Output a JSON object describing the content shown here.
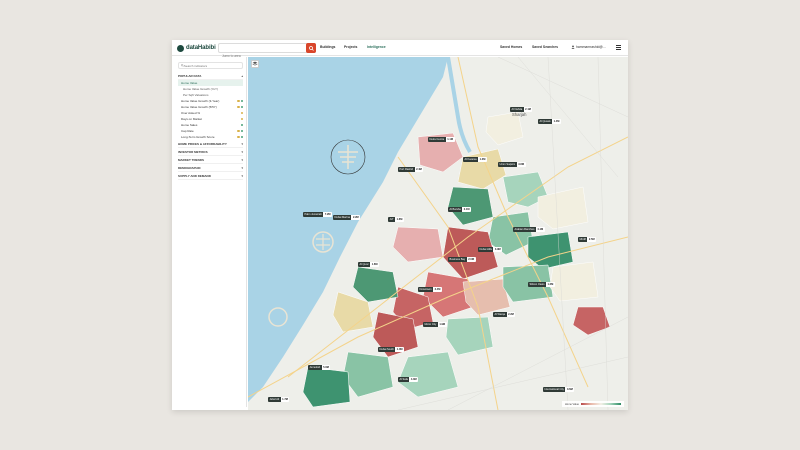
{
  "app": {
    "logo_text": "dataHabibi",
    "search_placeholder": "Jump to area",
    "nav": [
      "Buildings",
      "Projects",
      "Intelligence"
    ],
    "nav_active": "Intelligence",
    "right_links": [
      "Saved Homes",
      "Saved Searches"
    ],
    "user": "hammamrashid@..."
  },
  "sidebar": {
    "search_placeholder": "Search indicators",
    "sections": [
      {
        "title": "POPULAR DATA",
        "items": [
          {
            "label": "Home Value",
            "selected": true
          },
          {
            "label": "Home Value Growth (YoY)",
            "sub": true
          },
          {
            "label": "Per Sqft Valuations",
            "sub": true
          },
          {
            "label": "Home Value Growth (3-Year)",
            "dots": [
              "#d9b24a",
              "#4aa27a"
            ]
          },
          {
            "label": "Home Value Growth (5/5Y)",
            "dots": [
              "#d9b24a",
              "#4aa27a"
            ]
          },
          {
            "label": "Over Asked %",
            "dots": [
              "#d9b24a"
            ]
          },
          {
            "label": "Days on Market",
            "dots": [
              "#d9b24a"
            ]
          },
          {
            "label": "Home Sales",
            "dots": [
              "#4aa27a"
            ]
          },
          {
            "label": "Cap Rate",
            "dots": [
              "#d9b24a",
              "#4aa27a"
            ]
          },
          {
            "label": "Long-Term Growth Score",
            "dots": [
              "#d9b24a",
              "#4aa27a"
            ]
          }
        ]
      },
      {
        "title": "HOME PRICES & AFFORDABILITY"
      },
      {
        "title": "INVESTOR METRICS"
      },
      {
        "title": "MARKET TRENDS"
      },
      {
        "title": "DEMOGRAPHIC"
      },
      {
        "title": "SUPPLY AND DEMAND"
      }
    ]
  },
  "map": {
    "city_label": "Sharjah",
    "legend_label": "Home Value",
    "pins": [
      {
        "name": "Al Nahda",
        "value": "2.1M"
      },
      {
        "name": "Al Qusais",
        "value": "1.4M"
      },
      {
        "name": "Deira Centre",
        "value": "1.1M"
      },
      {
        "name": "Port Rashid",
        "value": "2.4M"
      },
      {
        "name": "Al Karama",
        "value": "1.3M"
      },
      {
        "name": "Umm Suqeim",
        "value": "3.8M"
      },
      {
        "name": "Palm Jumeirah",
        "value": "7.2M"
      },
      {
        "name": "Dubai Marina",
        "value": "2.2M"
      },
      {
        "name": "JLT",
        "value": "1.6M"
      },
      {
        "name": "Al Barsha",
        "value": "2.1M"
      },
      {
        "name": "Arabian Ranches",
        "value": "4.1M"
      },
      {
        "name": "Dubai Hills",
        "value": "3.9M"
      },
      {
        "name": "Business Bay",
        "value": "2.0M"
      },
      {
        "name": "Downtown",
        "value": "3.4M"
      },
      {
        "name": "Al Quoz",
        "value": "1.6M"
      },
      {
        "name": "Mirdif",
        "value": "2.5M"
      },
      {
        "name": "Silicon Oasis",
        "value": "1.2M"
      },
      {
        "name": "Al Warqa",
        "value": "2.2M"
      },
      {
        "name": "Motor City",
        "value": "1.9M"
      },
      {
        "name": "Dubai South",
        "value": "1.0M"
      },
      {
        "name": "Jumeirah",
        "value": "5.6M"
      },
      {
        "name": "Al Safa",
        "value": "4.3M"
      },
      {
        "name": "Jebel Ali",
        "value": "1.7M"
      },
      {
        "name": "International City",
        "value": "0.6M"
      }
    ]
  }
}
